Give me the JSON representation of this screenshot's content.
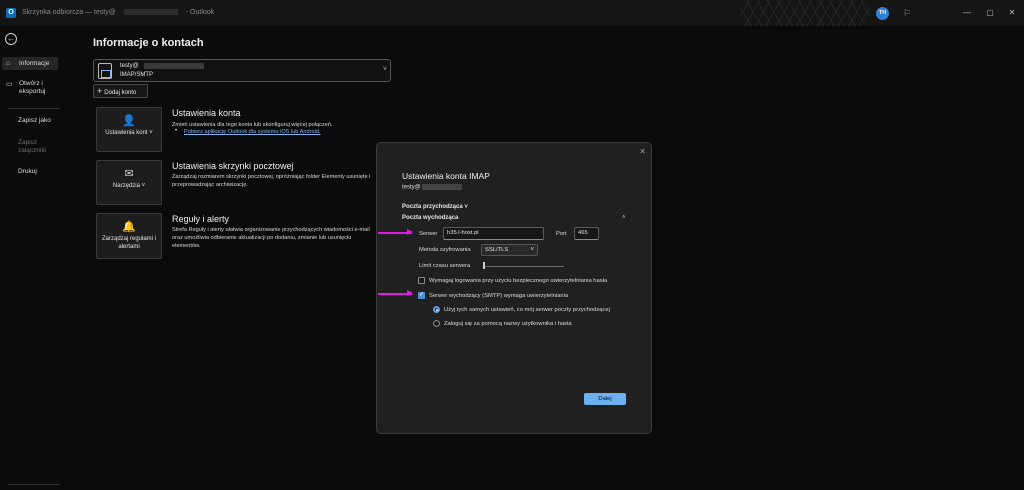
{
  "window": {
    "title": "Skrzynka odbiorcza — testy@",
    "title_suffix": "- Outlook",
    "avatar_initials": "TH",
    "app_icon": "O"
  },
  "backstage_nav": {
    "back_icon": "←",
    "items": [
      {
        "label": "Informacje",
        "icon": "home-icon"
      },
      {
        "label": "Otwórz i eksportuj",
        "icon": "folder-icon"
      },
      {
        "label": "Zapisz jako"
      },
      {
        "label": "Zapisz załączniki"
      },
      {
        "label": "Drukuj"
      }
    ]
  },
  "main": {
    "page_title": "Informacje o kontach",
    "account": {
      "name": "testy@",
      "type": "IMAP/SMTP"
    },
    "add_account_label": "Dodaj konto",
    "sections": [
      {
        "button_label": "Ustawienia kont ˅",
        "title": "Ustawienia konta",
        "desc": "Zmień ustawienia dla tego konta lub skonfiguruj więcej połączeń.",
        "link": "Pobierz aplikację Outlook dla systemu iOS lub Android."
      },
      {
        "button_label": "Narzędzia ˅",
        "title": "Ustawienia skrzynki pocztowej",
        "desc": "Zarządzaj rozmiarem skrzynki pocztowej, opróżniając folder Elementy usunięte i przeprowadzając archiwizację."
      },
      {
        "button_label": "Zarządzaj regułami i alertami",
        "title": "Reguły i alerty",
        "desc": "Strefa Reguły i alerty ułatwia organizowanie przychodzących wiadomości e-mail oraz umożliwia odbieranie aktualizacji po dodaniu, zmianie lub usunięciu elementów."
      }
    ]
  },
  "dialog": {
    "title": "Ustawienia konta IMAP",
    "email": "testy@",
    "incoming_label": "Poczta przychodząca",
    "incoming_chevron": "˅",
    "outgoing_label": "Poczta wychodząca",
    "outgoing_chevron": "˄",
    "server_label": "Serwer",
    "server_value": "h35.l-host.pl",
    "port_label": "Port",
    "port_value": "465",
    "encryption_label": "Metoda szyfrowania",
    "encryption_value": "SSL/TLS",
    "timeout_label": "Limit czasu serwera",
    "spa_label": "Wymagaj logowania przy użyciu bezpiecznego uwierzytelniania hasła",
    "spa_checked": false,
    "smtp_auth_label": "Serwer wychodzący (SMTP) wymaga uwierzytelniania",
    "smtp_auth_checked": true,
    "radio_same": "Użyj tych samych ustawień, co mój serwer poczty przychodzącej",
    "radio_login": "Zaloguj się za pomocą nazwy użytkownika i hasła",
    "next_label": "Dalej"
  },
  "colors": {
    "accent": "#6bb1f0",
    "annotation_arrow": "#e11ae6",
    "background": "#0b0b0b"
  }
}
